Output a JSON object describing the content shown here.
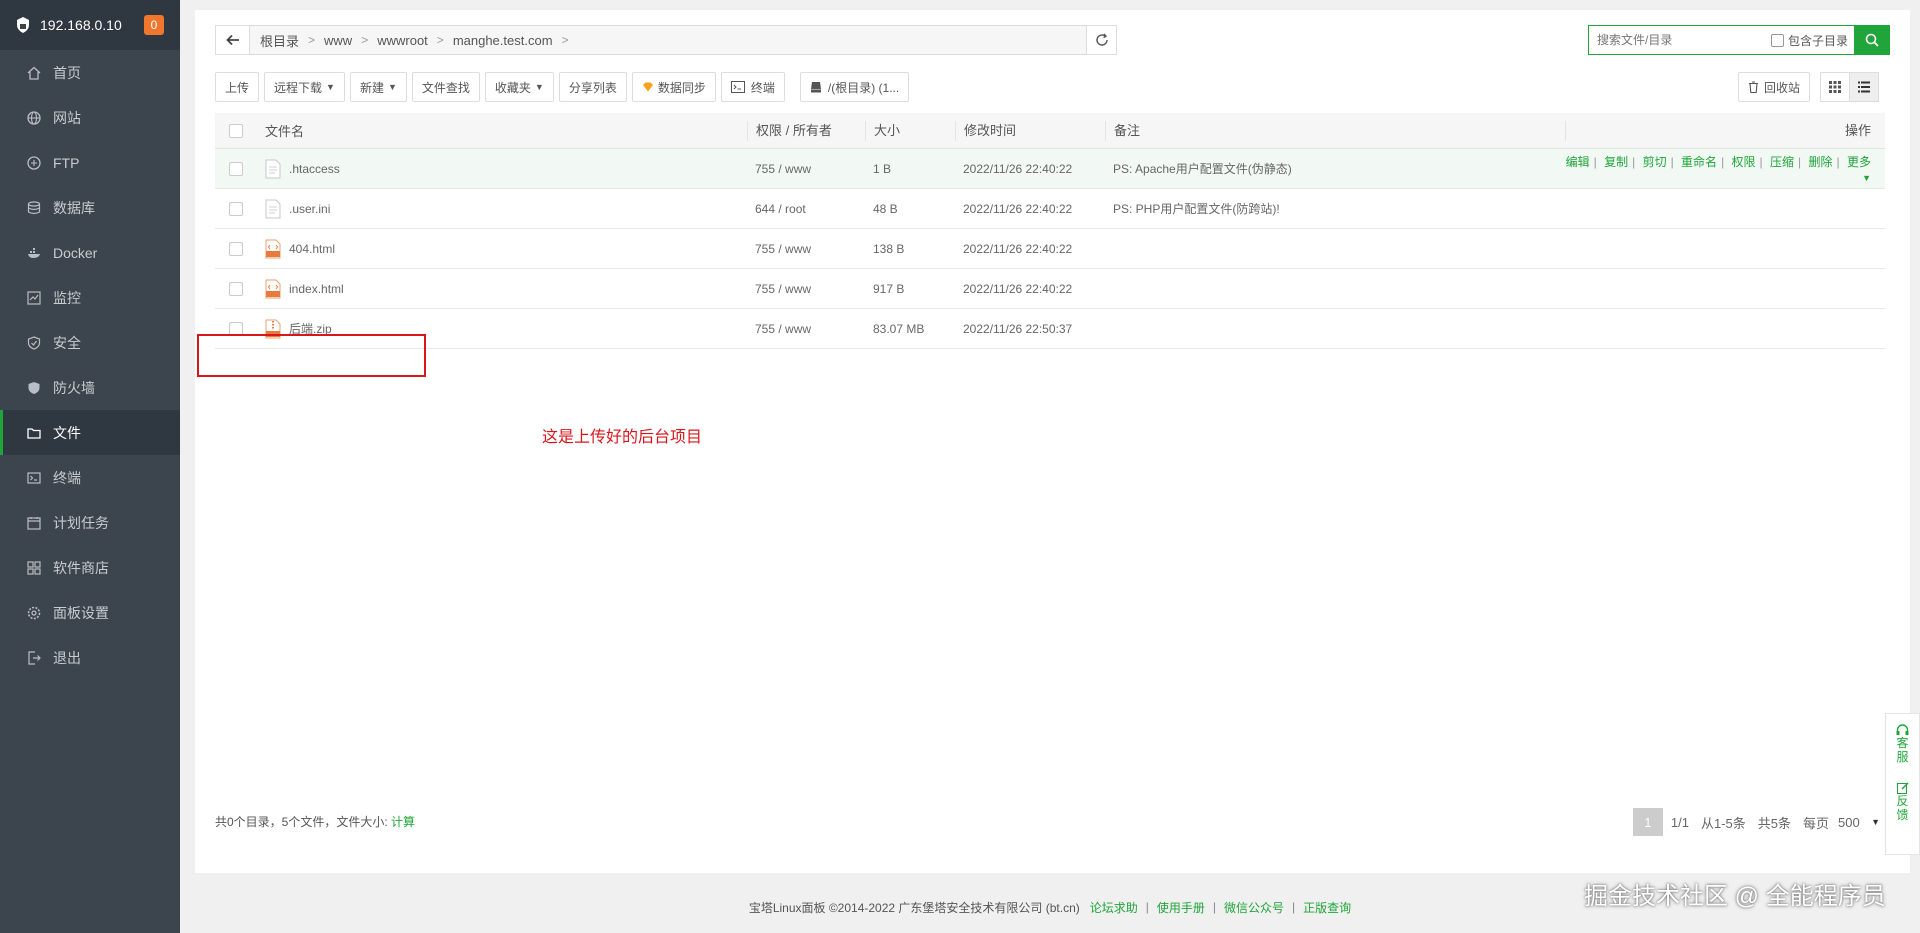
{
  "sidebar": {
    "server_ip": "192.168.0.10",
    "badge": "0",
    "items": [
      {
        "label": "首页",
        "icon": "home-icon"
      },
      {
        "label": "网站",
        "icon": "globe-icon"
      },
      {
        "label": "FTP",
        "icon": "ftp-icon"
      },
      {
        "label": "数据库",
        "icon": "database-icon"
      },
      {
        "label": "Docker",
        "icon": "docker-icon"
      },
      {
        "label": "监控",
        "icon": "monitor-icon"
      },
      {
        "label": "安全",
        "icon": "shield-icon"
      },
      {
        "label": "防火墙",
        "icon": "firewall-icon"
      },
      {
        "label": "文件",
        "icon": "folder-icon",
        "active": true
      },
      {
        "label": "终端",
        "icon": "terminal-icon"
      },
      {
        "label": "计划任务",
        "icon": "calendar-icon"
      },
      {
        "label": "软件商店",
        "icon": "grid-icon"
      },
      {
        "label": "面板设置",
        "icon": "gear-icon"
      },
      {
        "label": "退出",
        "icon": "logout-icon"
      }
    ]
  },
  "path": {
    "segments": [
      "根目录",
      "www",
      "wwwroot",
      "manghe.test.com"
    ]
  },
  "search": {
    "placeholder": "搜索文件/目录",
    "include_sub_label": "包含子目录"
  },
  "toolbar": {
    "upload": "上传",
    "remote_download": "远程下载",
    "new": "新建",
    "file_search": "文件查找",
    "favorites": "收藏夹",
    "share_list": "分享列表",
    "data_sync": "数据同步",
    "terminal": "终端",
    "disk": "/(根目录) (1...",
    "recycle": "回收站"
  },
  "table": {
    "headers": {
      "name": "文件名",
      "perm": "权限 / 所有者",
      "size": "大小",
      "mtime": "修改时间",
      "note": "备注",
      "ops": "操作"
    },
    "rows": [
      {
        "name": ".htaccess",
        "perm": "755 / www",
        "size": "1 B",
        "mtime": "2022/11/26 22:40:22",
        "note": "PS: Apache用户配置文件(伪静态)",
        "type": "file"
      },
      {
        "name": ".user.ini",
        "perm": "644 / root",
        "size": "48 B",
        "mtime": "2022/11/26 22:40:22",
        "note": "PS: PHP用户配置文件(防跨站)!",
        "type": "file"
      },
      {
        "name": "404.html",
        "perm": "755 / www",
        "size": "138 B",
        "mtime": "2022/11/26 22:40:22",
        "note": "",
        "type": "html"
      },
      {
        "name": "index.html",
        "perm": "755 / www",
        "size": "917 B",
        "mtime": "2022/11/26 22:40:22",
        "note": "",
        "type": "html"
      },
      {
        "name": "后端.zip",
        "perm": "755 / www",
        "size": "83.07 MB",
        "mtime": "2022/11/26 22:50:37",
        "note": "",
        "type": "zip"
      }
    ],
    "row_ops": [
      "编辑",
      "复制",
      "剪切",
      "重命名",
      "权限",
      "压缩",
      "删除",
      "更多"
    ]
  },
  "annotation": "这是上传好的后台项目",
  "footer": {
    "summary": "共0个目录，5个文件，文件大小:",
    "calc": "计算",
    "page_current": "1",
    "page_total": "1/1",
    "range": "从1-5条",
    "total": "共5条",
    "per_page_label": "每页",
    "per_page": "500",
    "unit": "条"
  },
  "bottom": {
    "copyright": "宝塔Linux面板 ©2014-2022 广东堡塔安全技术有限公司 (bt.cn)",
    "links": [
      "论坛求助",
      "使用手册",
      "微信公众号",
      "正版查询"
    ]
  },
  "side_help": {
    "service": "客服",
    "feedback": "反馈"
  },
  "watermark": "掘金技术社区 @ 全能程序员",
  "colors": {
    "accent": "#20a53a",
    "sidebar_bg": "#3c444d",
    "annotation": "#d9161c"
  }
}
